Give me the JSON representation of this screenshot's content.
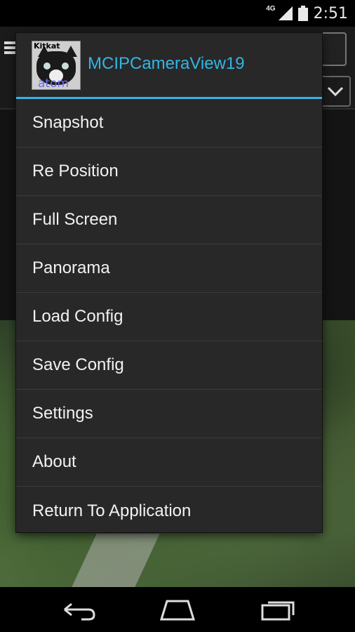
{
  "status_bar": {
    "network": "4G",
    "time": "2:51"
  },
  "menu": {
    "app_name": "MCIPCameraView19",
    "icon_text_top": "Kitkat",
    "icon_text_bottom": "atom",
    "items": [
      {
        "label": "Snapshot"
      },
      {
        "label": "Re Position"
      },
      {
        "label": "Full Screen"
      },
      {
        "label": "Panorama"
      },
      {
        "label": "Load Config"
      },
      {
        "label": "Save Config"
      },
      {
        "label": "Settings"
      },
      {
        "label": "About"
      },
      {
        "label": "Return To Application"
      }
    ]
  },
  "colors": {
    "accent": "#33b5e5",
    "menu_bg": "#282828"
  }
}
